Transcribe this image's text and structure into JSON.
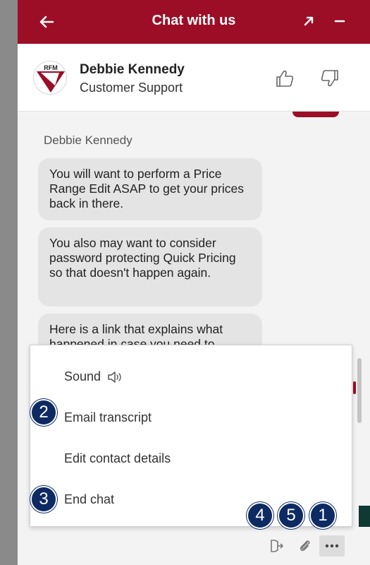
{
  "header": {
    "title": "Chat with us",
    "background": "#9b0e26",
    "icons": [
      "back-arrow-icon",
      "pop-out-icon",
      "minimize-icon"
    ]
  },
  "agent": {
    "name": "Debbie Kennedy",
    "role": "Customer Support",
    "avatar_text": "RFM"
  },
  "conversation": {
    "sender": "Debbie Kennedy",
    "messages": [
      "You will want to perform a Price Range Edit ASAP to get your prices back in there.",
      "You also may want to consider password protecting Quick Pricing so that doesn't happen again.",
      "Here is a link that explains what happened in case you need to"
    ]
  },
  "menu": {
    "items": [
      "Sound",
      "Email transcript",
      "Edit contact details",
      "End chat"
    ]
  },
  "badges": {
    "email": "2",
    "end": "3",
    "exit": "4",
    "attach": "5",
    "more": "1",
    "color": "#0d2a63"
  }
}
